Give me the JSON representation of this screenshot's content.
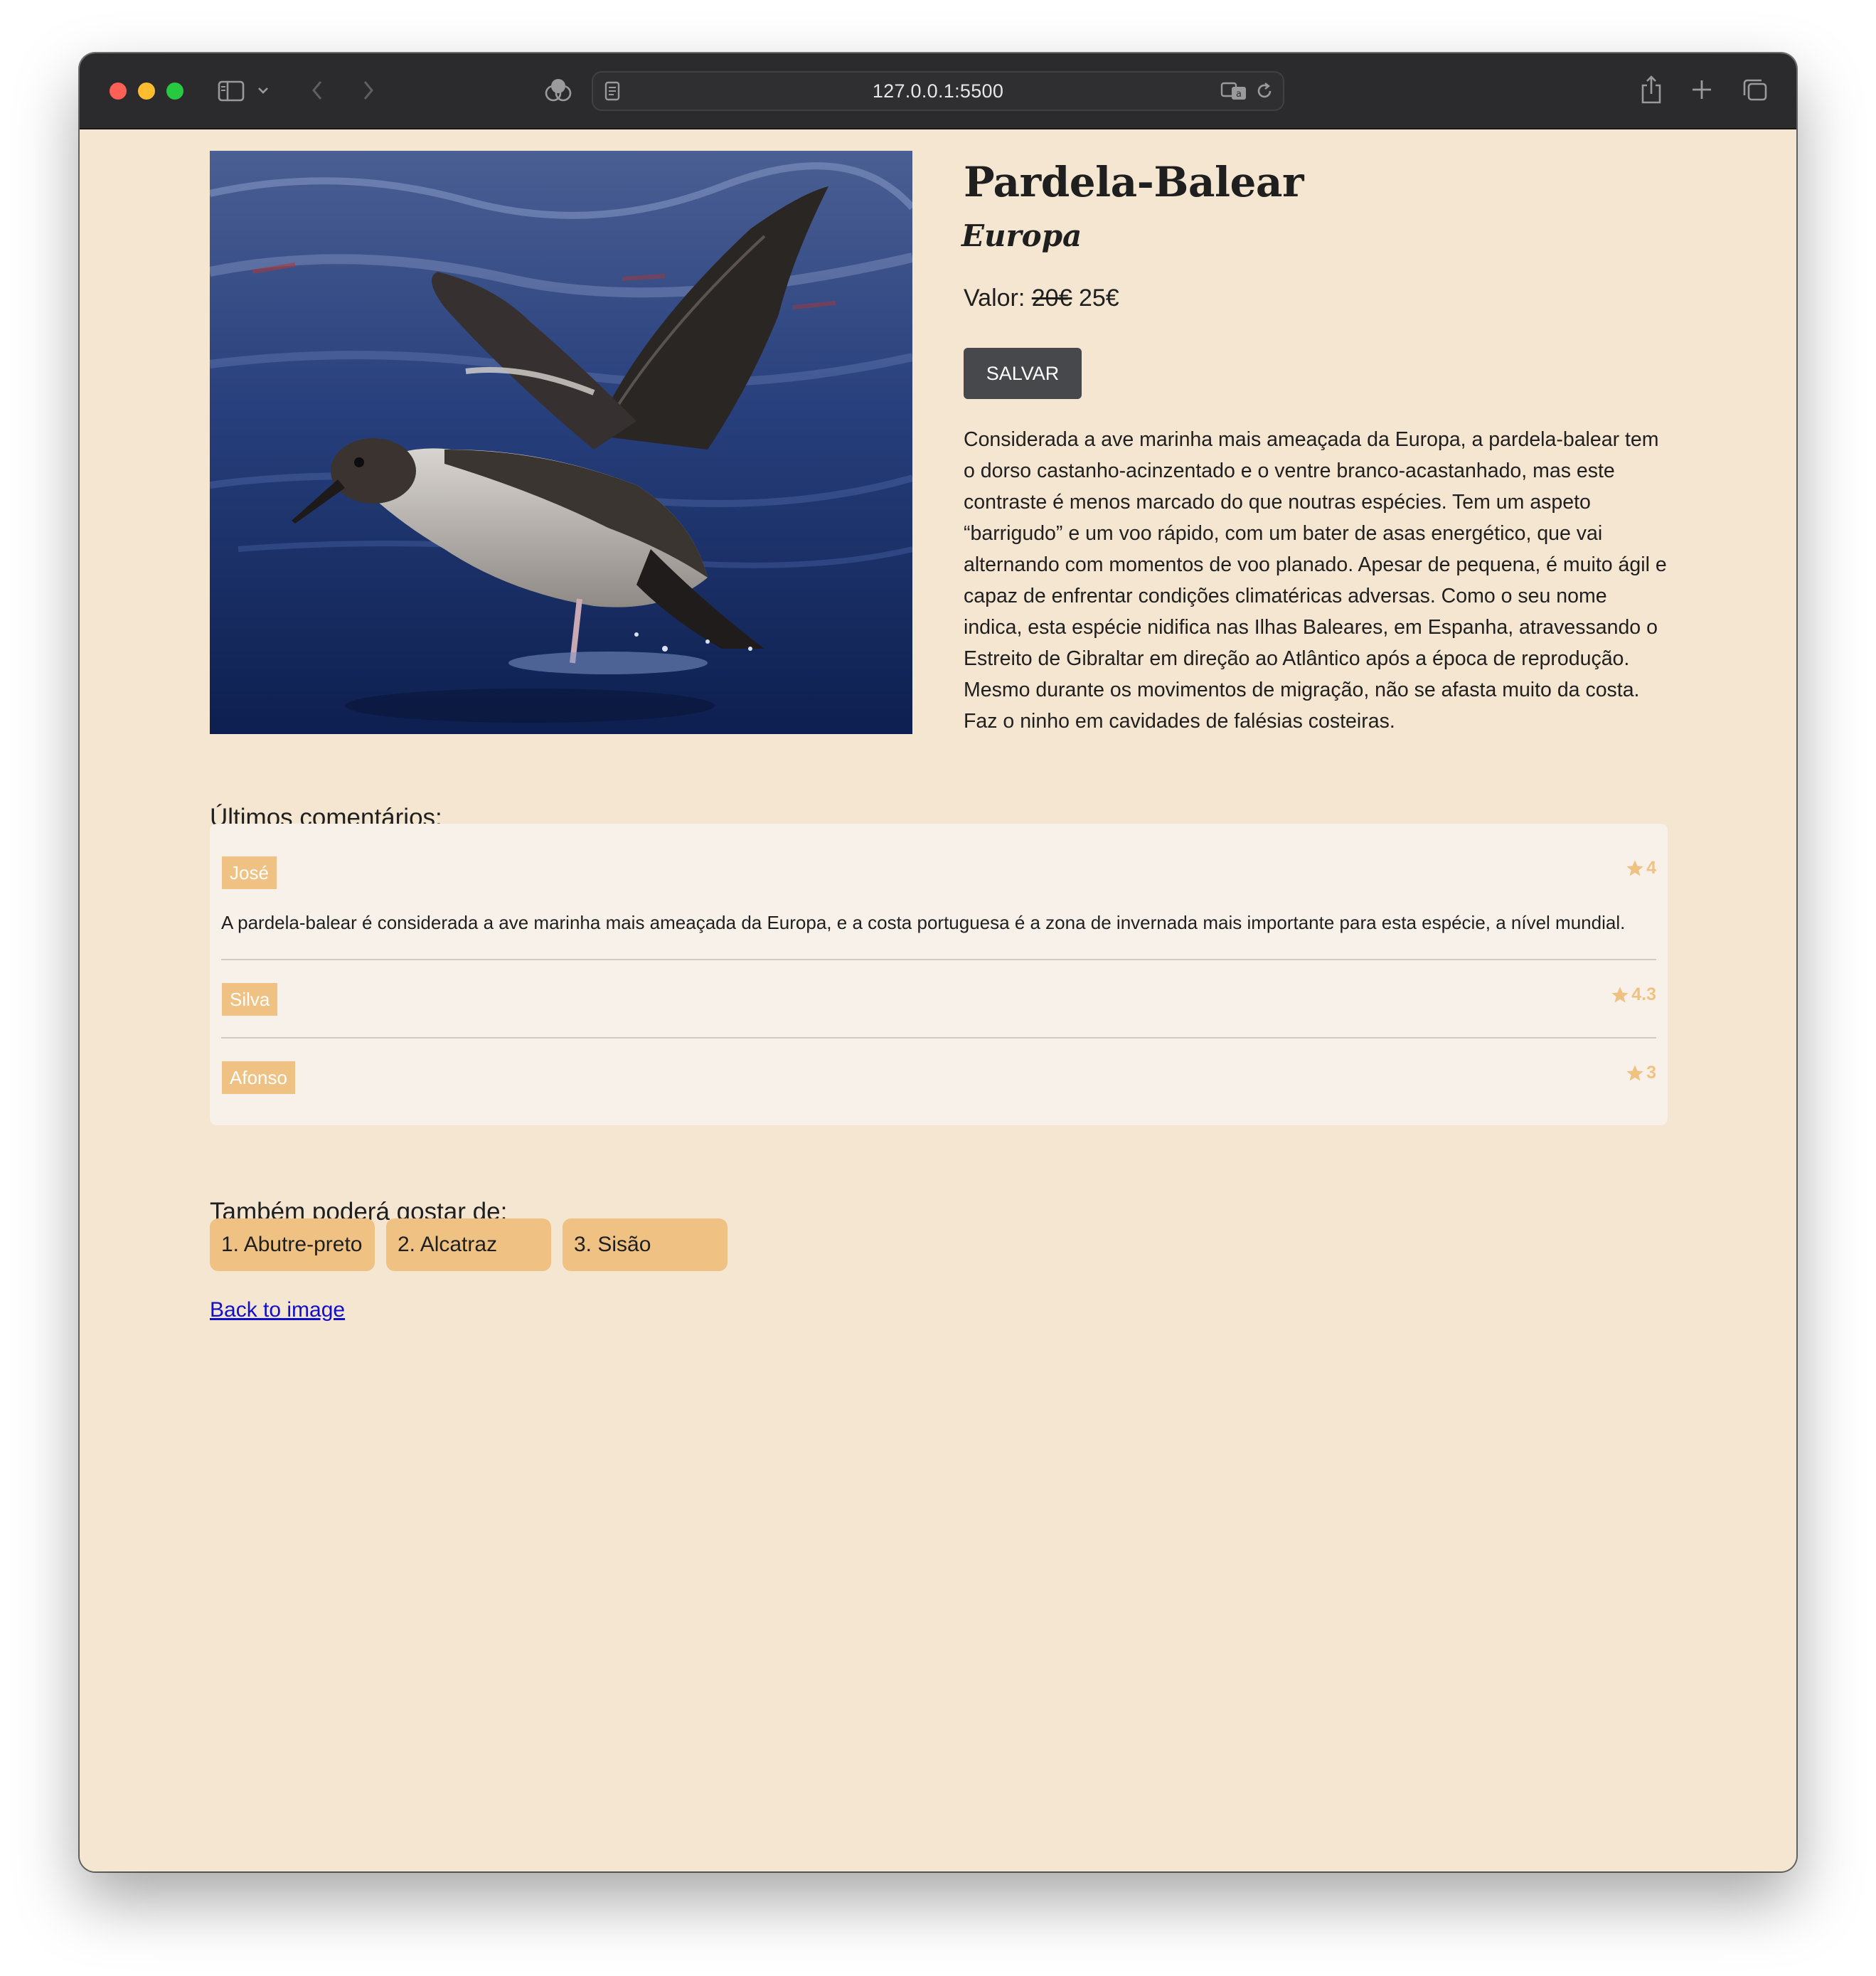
{
  "browser": {
    "url": "127.0.0.1:5500"
  },
  "product": {
    "title": "Pardela-Balear",
    "region": "Europa",
    "price_label": "Valor:",
    "old_price": "20€",
    "new_price": "25€",
    "save_label": "SALVAR",
    "description": "Considerada a ave marinha mais ameaçada da Europa, a pardela-balear tem o dorso castanho-acinzentado e o ventre branco-acastanhado, mas este contraste é menos marcado do que noutras espécies. Tem um aspeto “barrigudo” e um voo rápido, com um bater de asas energético, que vai alternando com momentos de voo planado. Apesar de pequena, é muito ágil e capaz de enfrentar condições climatéricas adversas. Como o seu nome indica, esta espécie nidifica nas Ilhas Baleares, em Espanha, atravessando o Estreito de Gibraltar em direção ao Atlântico após a época de reprodução. Mesmo durante os movimentos de migração, não se afasta muito da costa. Faz o ninho em cavidades de falésias costeiras."
  },
  "comments_heading": "Últimos comentários:",
  "comments": [
    {
      "name": "José",
      "rating": "4",
      "text": "A pardela-balear é considerada a ave marinha mais ameaçada da Europa, e a costa portuguesa é a zona de invernada mais importante para esta espécie, a nível mundial."
    },
    {
      "name": "Silva",
      "rating": "4.3",
      "text": ""
    },
    {
      "name": "Afonso",
      "rating": "3",
      "text": ""
    }
  ],
  "suggestions_heading": "Também poderá gostar de:",
  "suggestions": [
    "1. Abutre-preto",
    "2. Alcatraz",
    "3. Sisão"
  ],
  "back_link": "Back to image",
  "colors": {
    "page_background": "#f5e6d1",
    "accent": "#efc283",
    "button": "#46484c",
    "link": "#1010cc"
  }
}
